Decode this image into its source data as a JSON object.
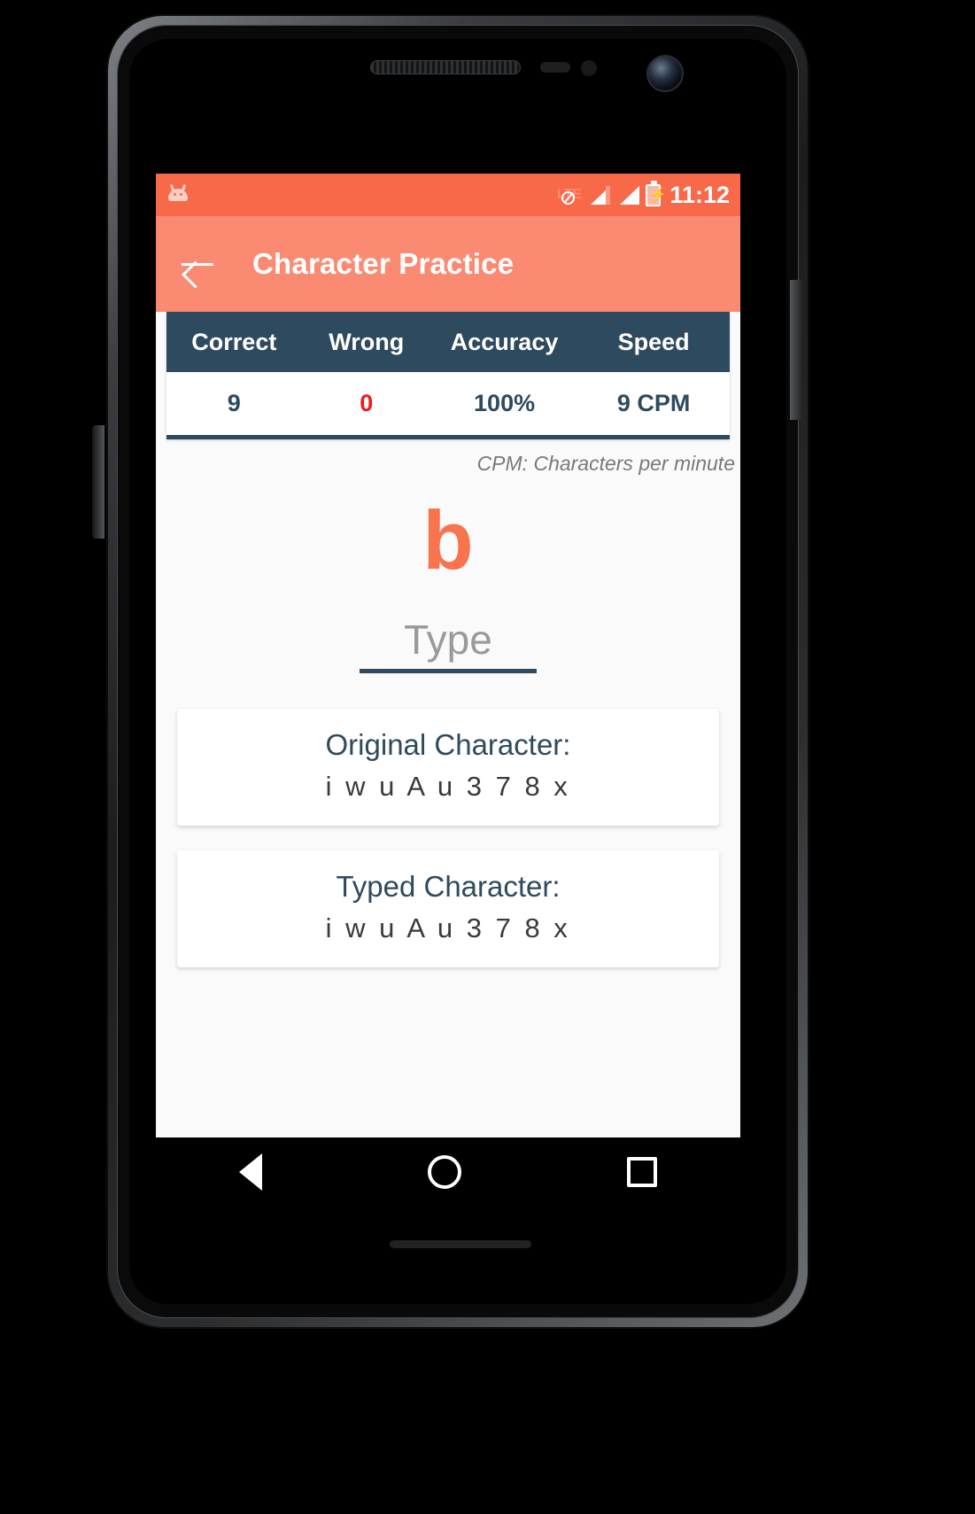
{
  "device": {
    "earpiece": "earpiece-speaker",
    "front_camera": "front-camera"
  },
  "status_bar": {
    "app_icon": "android-logo-icon",
    "network_label": "LTE",
    "network_state_icon": "no-data-slash-icon",
    "signal_icon_1": "signal-bars-icon",
    "signal_icon_2": "signal-bars-icon",
    "battery_icon": "battery-charging-icon",
    "time": "11:12"
  },
  "app_bar": {
    "back_icon": "back-arrow-icon",
    "title": "Character Practice"
  },
  "stats": {
    "headers": {
      "correct": "Correct",
      "wrong": "Wrong",
      "accuracy": "Accuracy",
      "speed": "Speed"
    },
    "values": {
      "correct": "9",
      "wrong": "0",
      "accuracy": "100%",
      "speed": "9 CPM"
    },
    "legend": "CPM: Characters per minute",
    "wrong_color": "#f01b1b",
    "header_bg": "#2e4a5e"
  },
  "practice": {
    "prompt_character": "b",
    "prompt_color": "#f8744f",
    "input_value": "",
    "input_placeholder": "Type"
  },
  "cards": {
    "original": {
      "label": "Original Character:",
      "value": "i w u A u 3 7 8 x"
    },
    "typed": {
      "label": "Typed Character:",
      "value": "i w u A u 3 7 8 x"
    }
  },
  "nav_bar": {
    "back": "nav-back-icon",
    "home": "nav-home-icon",
    "recents": "nav-recents-icon"
  },
  "theme": {
    "accent": "#fa8a72",
    "status_bar": "#f8694a",
    "dark": "#2e4a5e",
    "page_bg": "#fafafa"
  }
}
